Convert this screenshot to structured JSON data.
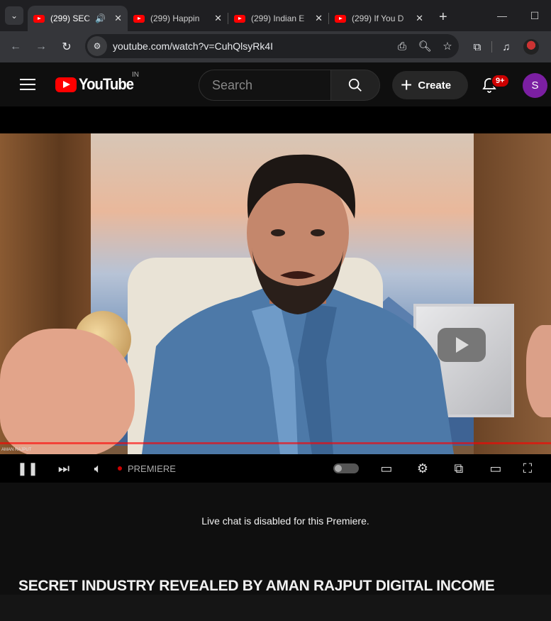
{
  "browser": {
    "tabs": [
      {
        "title": "(299) SEC",
        "active": true,
        "audio": true
      },
      {
        "title": "(299) Happin",
        "active": false
      },
      {
        "title": "(299) Indian E",
        "active": false
      },
      {
        "title": "(299) If You D",
        "active": false
      }
    ],
    "url": "youtube.com/watch?v=CuhQlsyRk4I"
  },
  "youtube": {
    "logo_text": "YouTube",
    "country_code": "IN",
    "search_placeholder": "Search",
    "create_label": "Create",
    "notification_count": "9+",
    "avatar_initial": "S"
  },
  "player": {
    "watermark": "AMAN RAJPUT",
    "status_label": "PREMIERE",
    "progress": 1.0
  },
  "chat": {
    "message": "Live chat is disabled for this Premiere."
  },
  "video": {
    "title": "SECRET INDUSTRY REVEALED BY AMAN RAJPUT DIGITAL INCOME"
  }
}
